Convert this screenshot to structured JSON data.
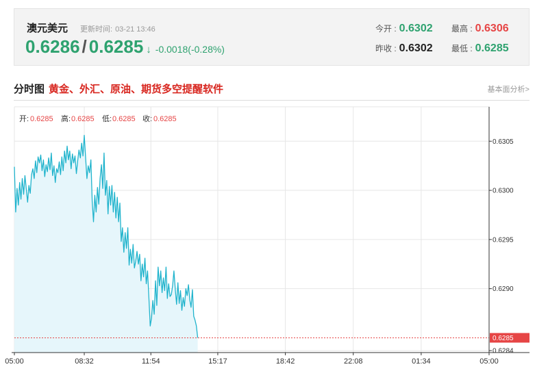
{
  "header": {
    "title": "澳元美元",
    "update_label": "更新时间:",
    "update_time": "03-21 13:46",
    "bid": "0.6286",
    "slash": "/",
    "ask": "0.6285",
    "arrow": "↓",
    "change": "-0.0018(-0.28%)",
    "open_label": "今开 :",
    "open": "0.6302",
    "high_label": "最高 :",
    "high": "0.6306",
    "prev_close_label": "昨收 :",
    "prev_close": "0.6302",
    "low_label": "最低 :",
    "low": "0.6285"
  },
  "section": {
    "title": "分时图",
    "link": "黄金、外汇、原油、期货多空提醒软件",
    "more": "基本面分析>"
  },
  "colors": {
    "up": "#e64545",
    "down": "#2ea26f",
    "line": "#1fb3cc",
    "area": "#e6f6fb",
    "grid": "#e6e6e6"
  },
  "chart_data": {
    "type": "area",
    "ohlc": {
      "open_label": "开:",
      "open": "0.6285",
      "high_label": "高:",
      "high": "0.6285",
      "low_label": "低:",
      "low": "0.6285",
      "close_label": "收:",
      "close": "0.6285"
    },
    "x_ticks": [
      "05:00",
      "08:32",
      "11:54",
      "15:17",
      "18:42",
      "22:08",
      "01:34",
      "05:00"
    ],
    "x_tick_minutes": [
      0,
      212,
      414,
      617,
      822,
      1028,
      1234,
      1440
    ],
    "y_ticks": [
      "0.6305",
      "0.6300",
      "0.6295",
      "0.6290",
      "0.6284"
    ],
    "y_tick_values": [
      0.6305,
      0.63,
      0.6295,
      0.629,
      0.62837
    ],
    "ylim": [
      0.62835,
      0.63085
    ],
    "xlim": [
      0,
      1440
    ],
    "last_price": "0.6285",
    "last_value": 0.6285,
    "series": [
      {
        "x": [
          0,
          4,
          8,
          12,
          16,
          20,
          24,
          28,
          32,
          36,
          40,
          44,
          48,
          52,
          56,
          60,
          64,
          68,
          72,
          76,
          80,
          84,
          88,
          92,
          96,
          100,
          104,
          108,
          112,
          116,
          120,
          124,
          128,
          132,
          136,
          140,
          144,
          148,
          152,
          156,
          160,
          164,
          168,
          172,
          176,
          180,
          184,
          188,
          192,
          196,
          200,
          204,
          208,
          212,
          216,
          220,
          224,
          228,
          232,
          236,
          240,
          244,
          248,
          252,
          256,
          260,
          264,
          268,
          272,
          276,
          280,
          284,
          288,
          292,
          296,
          300,
          304,
          308,
          312,
          316,
          320,
          324,
          328,
          332,
          336,
          340,
          344,
          348,
          352,
          356,
          360,
          364,
          368,
          372,
          376,
          380,
          384,
          388,
          392,
          396,
          400,
          404,
          408,
          412,
          416,
          420,
          424,
          428,
          432,
          436,
          440,
          444,
          448,
          452,
          456,
          460,
          464,
          468,
          472,
          476,
          480,
          484,
          488,
          492,
          496,
          500,
          504,
          508,
          512,
          516,
          520,
          524,
          528,
          532,
          536,
          540,
          544,
          548,
          552,
          556
        ],
        "values": [
          0.63024,
          0.62978,
          0.63002,
          0.62985,
          0.63008,
          0.62991,
          0.63012,
          0.62996,
          0.63015,
          0.63002,
          0.62988,
          0.63005,
          0.62997,
          0.63016,
          0.63022,
          0.63012,
          0.6303,
          0.63018,
          0.63034,
          0.63028,
          0.63036,
          0.6302,
          0.63031,
          0.63014,
          0.63026,
          0.63019,
          0.63033,
          0.63021,
          0.63038,
          0.63015,
          0.63025,
          0.63008,
          0.63022,
          0.63018,
          0.63029,
          0.63016,
          0.63034,
          0.6302,
          0.6304,
          0.63028,
          0.63045,
          0.63031,
          0.6304,
          0.63022,
          0.63037,
          0.63028,
          0.63035,
          0.63017,
          0.6303,
          0.63041,
          0.63033,
          0.63048,
          0.63035,
          0.63056,
          0.63033,
          0.63012,
          0.63025,
          0.63018,
          0.63031,
          0.62989,
          0.62968,
          0.62995,
          0.62978,
          0.63003,
          0.62986,
          0.63012,
          0.63026,
          0.63002,
          0.63038,
          0.62995,
          0.6301,
          0.62976,
          0.63004,
          0.62985,
          0.63005,
          0.62978,
          0.62998,
          0.62972,
          0.62993,
          0.62968,
          0.62987,
          0.62948,
          0.62962,
          0.62937,
          0.62957,
          0.62941,
          0.62962,
          0.62924,
          0.6294,
          0.62926,
          0.62945,
          0.62921,
          0.62928,
          0.62938,
          0.62925,
          0.62935,
          0.62908,
          0.62925,
          0.62912,
          0.62931,
          0.62905,
          0.62918,
          0.62892,
          0.62862,
          0.6287,
          0.62888,
          0.62874,
          0.62908,
          0.62883,
          0.62922,
          0.62903,
          0.62918,
          0.62896,
          0.62911,
          0.62898,
          0.62922,
          0.6289,
          0.62905,
          0.62892,
          0.62894,
          0.62903,
          0.62918,
          0.62899,
          0.62884,
          0.62906,
          0.62885,
          0.62898,
          0.62878,
          0.62891,
          0.62882,
          0.629,
          0.62893,
          0.62904,
          0.62889,
          0.62881,
          0.62899,
          0.62872,
          0.62868,
          0.62862,
          0.6285
        ]
      }
    ]
  }
}
